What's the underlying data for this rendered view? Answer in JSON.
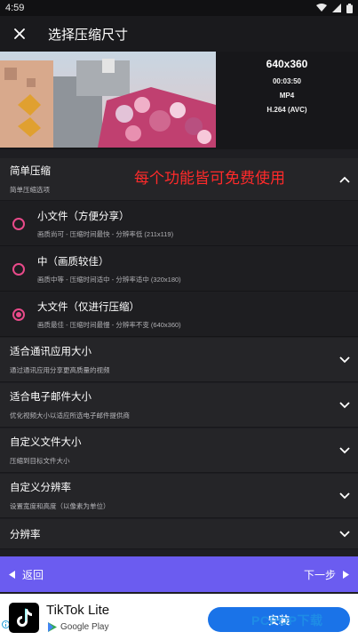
{
  "status_bar": {
    "time": "4:59"
  },
  "app_bar": {
    "title": "选择压缩尺寸"
  },
  "video": {
    "resolution": "640x360",
    "duration": "00:03:50",
    "format": "MP4",
    "codec": "H.264 (AVC)"
  },
  "simple": {
    "title": "简单压缩",
    "subtitle": "简单压缩选项",
    "promo": "每个功能皆可免费使用"
  },
  "options": [
    {
      "label": "小文件（方便分享）",
      "desc": "画质尚可 - 压缩时间最快 - 分辨率低 (211x119)",
      "selected": false
    },
    {
      "label": "中（画质较佳）",
      "desc": "画质中等 - 压缩时间适中 - 分辨率适中 (320x180)",
      "selected": false
    },
    {
      "label": "大文件（仅进行压缩）",
      "desc": "画质最佳 - 压缩时间最慢 - 分辨率不变 (640x360)",
      "selected": true
    }
  ],
  "sections": [
    {
      "title": "适合通讯应用大小",
      "subtitle": "通过通讯应用分享更高质量的视频"
    },
    {
      "title": "适合电子邮件大小",
      "subtitle": "优化视频大小以适应所选电子邮件提供商"
    },
    {
      "title": "自定义文件大小",
      "subtitle": "压缩到目标文件大小"
    },
    {
      "title": "自定义分辨率",
      "subtitle": "设置宽度和高度（以像素为单位）"
    },
    {
      "title": "分辨率",
      "subtitle": ""
    }
  ],
  "nav": {
    "back": "返回",
    "next": "下一步"
  },
  "ad": {
    "app_name": "TikTok Lite",
    "store": "Google Play",
    "install": "安装",
    "watermark": "PCPOP下载"
  },
  "colors": {
    "accent": "#e94a8a",
    "nav": "#6b5cf0",
    "promo": "#ff2a2a",
    "install": "#1a73e8"
  }
}
